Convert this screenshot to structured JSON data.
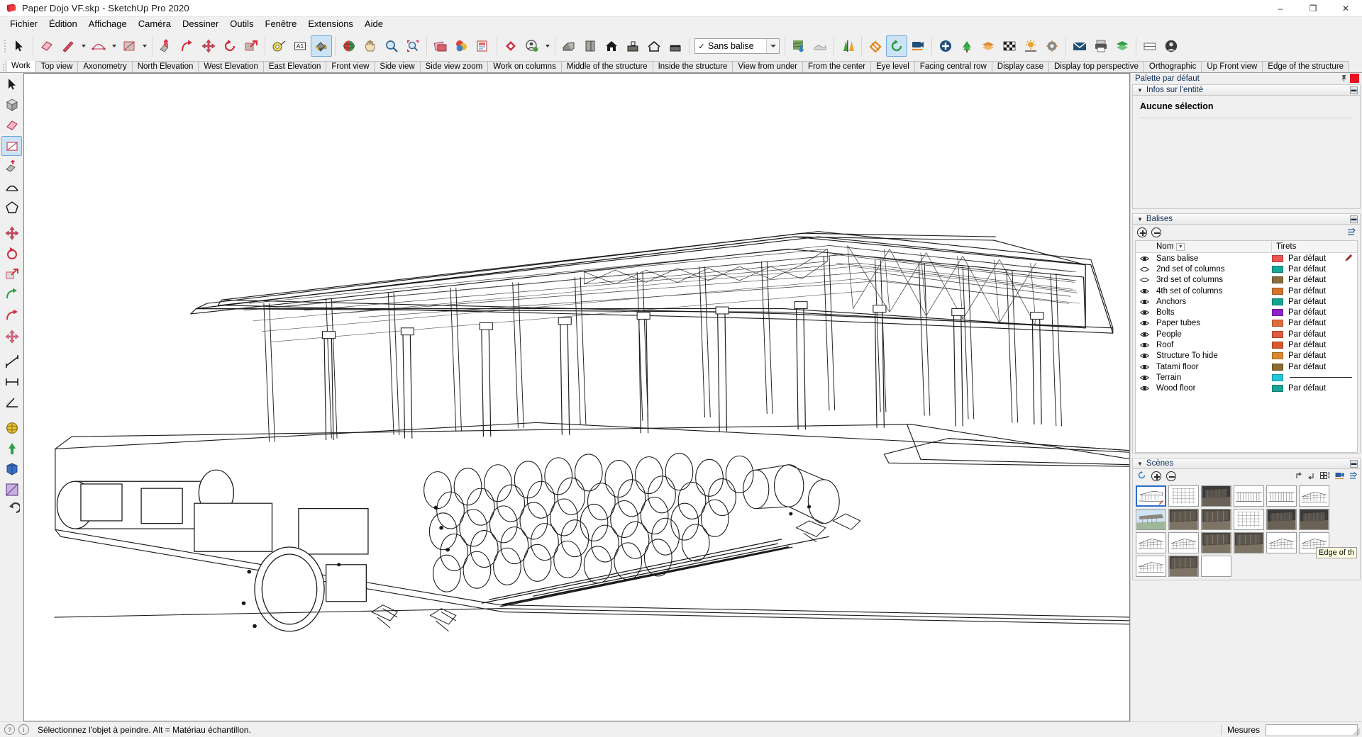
{
  "window": {
    "title": "Paper Dojo VF.skp - SketchUp Pro 2020",
    "minimize": "–",
    "maximize": "❐",
    "close": "✕"
  },
  "menubar": {
    "items": [
      "Fichier",
      "Édition",
      "Affichage",
      "Caméra",
      "Dessiner",
      "Outils",
      "Fenêtre",
      "Extensions",
      "Aide"
    ]
  },
  "toolbar": {
    "tag_selector": {
      "value": "Sans balise",
      "check": "✓"
    },
    "buttons": [
      {
        "name": "select-tool",
        "title": "Sélectionner"
      },
      {
        "name": "eraser-tool",
        "title": "Gomme"
      },
      {
        "name": "line-tool",
        "title": "Ligne"
      },
      {
        "name": "arc-tool",
        "title": "Arc"
      },
      {
        "name": "rectangle-tool",
        "title": "Rectangle"
      },
      {
        "name": "push-pull-tool",
        "title": "Pousser/Tirer"
      },
      {
        "name": "follow-me-tool",
        "title": "Suivez-moi"
      },
      {
        "name": "move-tool",
        "title": "Déplacer"
      },
      {
        "name": "rotate-tool",
        "title": "Faire pivoter"
      },
      {
        "name": "scale-tool",
        "title": "Mettre à l'échelle"
      },
      {
        "name": "tape-measure-tool",
        "title": "Mètre"
      },
      {
        "name": "dimension-tool",
        "title": "Cotation"
      },
      {
        "name": "paint-bucket-tool",
        "title": "Colorier",
        "active": true
      },
      {
        "name": "orbit-tool",
        "title": "Orbite"
      },
      {
        "name": "pan-tool",
        "title": "Panoramique"
      },
      {
        "name": "zoom-tool",
        "title": "Zoom"
      },
      {
        "name": "zoom-extents-tool",
        "title": "Zoom étendu"
      }
    ]
  },
  "scene_tabs": {
    "active": "Work",
    "items": [
      "Work",
      "Top view",
      "Axonometry",
      "North Elevation",
      "West Elevation",
      "East Elevation",
      "Front view",
      "Side view",
      "Side view zoom",
      "Work on columns",
      "Middle of the structure",
      "Inside the structure",
      "View from under",
      "From the center",
      "Eye level",
      "Facing central row",
      "Display case",
      "Display top perspective",
      "Orthographic",
      "Up Front view",
      "Edge of the structure"
    ]
  },
  "tray": {
    "title": "Palette par défaut",
    "pin_icon": "pin-icon",
    "close_icon": "close-icon"
  },
  "entity_info": {
    "header": "Infos sur l'entité",
    "status": "Aucune sélection",
    "collapse_icon": "caret-down-icon",
    "minimize_icon": "minimize-icon"
  },
  "balises": {
    "header": "Balises",
    "add_label": "+",
    "remove_label": "−",
    "columns": {
      "eye": "",
      "name": "Nom",
      "dashes": "Tirets"
    },
    "rows": [
      {
        "name": "Sans balise",
        "visible": true,
        "color": "#ef5350",
        "dash": "Par défaut",
        "dash_is_line": false,
        "has_pencil": true
      },
      {
        "name": "2nd set of columns",
        "visible": false,
        "color": "#17a598",
        "dash": "Par défaut",
        "dash_is_line": false,
        "has_pencil": false
      },
      {
        "name": "3rd set of columns",
        "visible": false,
        "color": "#8a6d3b",
        "dash": "Par défaut",
        "dash_is_line": false,
        "has_pencil": false
      },
      {
        "name": "4th set of columns",
        "visible": true,
        "color": "#d4742a",
        "dash": "Par défaut",
        "dash_is_line": false,
        "has_pencil": false
      },
      {
        "name": "Anchors",
        "visible": true,
        "color": "#15a58f",
        "dash": "Par défaut",
        "dash_is_line": false,
        "has_pencil": false
      },
      {
        "name": "Bolts",
        "visible": true,
        "color": "#8e24c8",
        "dash": "Par défaut",
        "dash_is_line": false,
        "has_pencil": false
      },
      {
        "name": "Paper tubes",
        "visible": true,
        "color": "#e06a3a",
        "dash": "Par défaut",
        "dash_is_line": false,
        "has_pencil": false
      },
      {
        "name": "People",
        "visible": true,
        "color": "#e15c3e",
        "dash": "Par défaut",
        "dash_is_line": false,
        "has_pencil": false
      },
      {
        "name": "Roof",
        "visible": true,
        "color": "#d9582e",
        "dash": "Par défaut",
        "dash_is_line": false,
        "has_pencil": false
      },
      {
        "name": "Structure To hide",
        "visible": true,
        "color": "#d98a2e",
        "dash": "Par défaut",
        "dash_is_line": false,
        "has_pencil": false
      },
      {
        "name": "Tatami floor",
        "visible": true,
        "color": "#8a6a2e",
        "dash": "Par défaut",
        "dash_is_line": false,
        "has_pencil": false
      },
      {
        "name": "Terrain",
        "visible": true,
        "color": "#22c7dc",
        "dash": "",
        "dash_is_line": true,
        "has_pencil": false
      },
      {
        "name": "Wood floor",
        "visible": true,
        "color": "#17a598",
        "dash": "Par défaut",
        "dash_is_line": false,
        "has_pencil": false
      }
    ]
  },
  "scenes": {
    "header": "Scènes",
    "tooltip": "Edge of th",
    "thumbnails": [
      {
        "name": "Work",
        "selected": true,
        "kind": "perspective",
        "pencil": true
      },
      {
        "name": "Top view",
        "selected": false,
        "kind": "grid"
      },
      {
        "name": "Axonometry",
        "selected": false,
        "kind": "dark"
      },
      {
        "name": "North Elevation",
        "selected": false,
        "kind": "elevation"
      },
      {
        "name": "West Elevation",
        "selected": false,
        "kind": "elevation"
      },
      {
        "name": "East Elevation",
        "selected": false,
        "kind": "wire"
      },
      {
        "name": "Front view",
        "selected": false,
        "kind": "render"
      },
      {
        "name": "Side view",
        "selected": false,
        "kind": "interior"
      },
      {
        "name": "Side view zoom",
        "selected": false,
        "kind": "interior"
      },
      {
        "name": "Work on columns",
        "selected": false,
        "kind": "grid"
      },
      {
        "name": "Middle of the structure",
        "selected": false,
        "kind": "dark"
      },
      {
        "name": "Inside the structure",
        "selected": false,
        "kind": "dark"
      },
      {
        "name": "View from under",
        "selected": false,
        "kind": "wire"
      },
      {
        "name": "From the center",
        "selected": false,
        "kind": "wire"
      },
      {
        "name": "Eye level",
        "selected": false,
        "kind": "interior"
      },
      {
        "name": "Facing central row",
        "selected": false,
        "kind": "interior"
      },
      {
        "name": "Display case",
        "selected": false,
        "kind": "wire"
      },
      {
        "name": "Display top perspective",
        "selected": false,
        "kind": "wire"
      },
      {
        "name": "Orthographic",
        "selected": false,
        "kind": "wire"
      },
      {
        "name": "Up Front view",
        "selected": false,
        "kind": "interior"
      },
      {
        "name": "Edge of the structure",
        "selected": false,
        "kind": "blank"
      }
    ]
  },
  "statusbar": {
    "message": "Sélectionnez l'objet à peindre. Alt = Matériau échantillon.",
    "measure_label": "Mesures",
    "measure_value": ""
  }
}
